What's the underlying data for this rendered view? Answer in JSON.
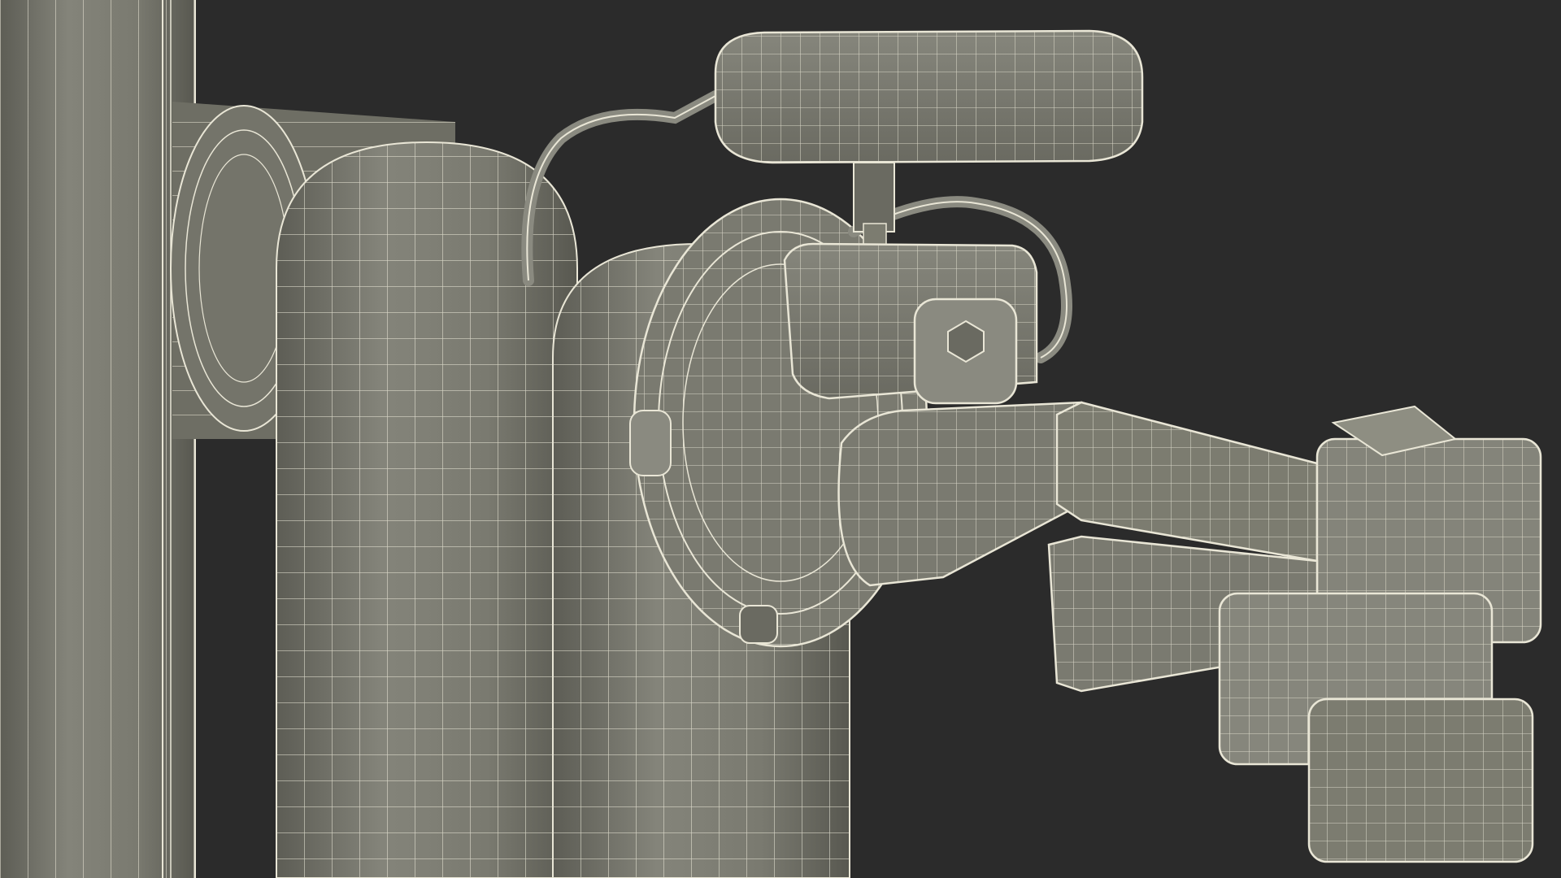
{
  "scene": {
    "background_color": "#2b2b2b",
    "mesh_fill_color": "#7c7c70",
    "mesh_shadow_color": "#5e5e55",
    "mesh_highlight_color": "#8e8e82",
    "wire_color": "#e9e6d6",
    "subject": "robotic-arm-gripper-wireframe-render"
  }
}
